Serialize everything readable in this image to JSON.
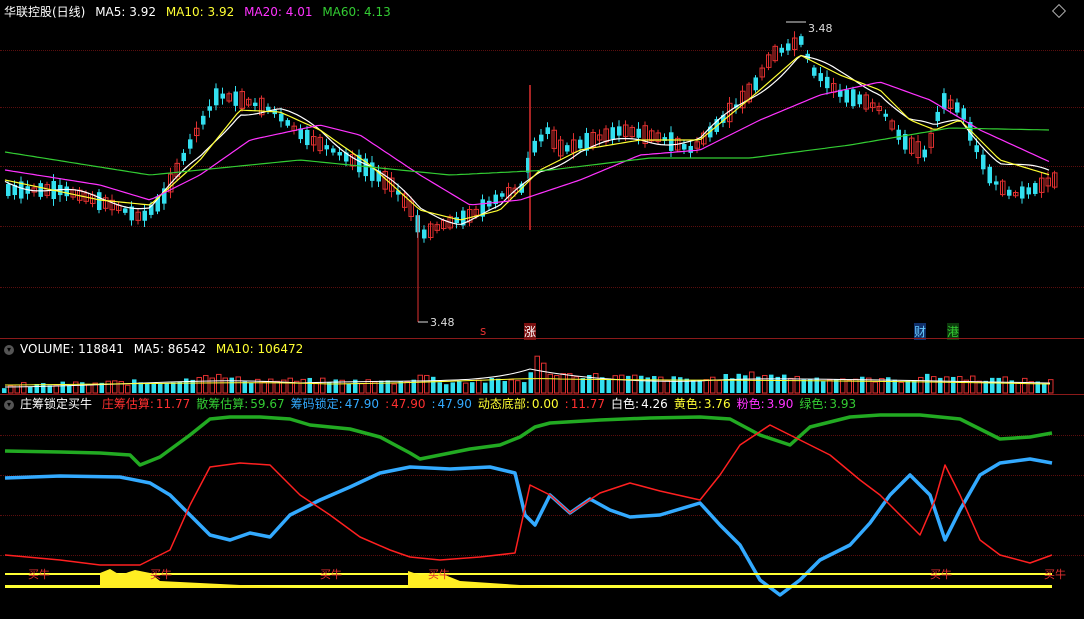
{
  "main": {
    "title": "华联控股(日线)",
    "ma5": "MA5: 3.92",
    "ma10": "MA10: 3.92",
    "ma20": "MA20: 4.01",
    "ma60": "MA60: 4.13",
    "high_label": "3.48",
    "low_label": "3.48",
    "markers": [
      {
        "text": "s",
        "color": "#e03030"
      },
      {
        "text": "涨",
        "color": "#ffffff"
      },
      {
        "text": "财",
        "color": "#66ccff"
      },
      {
        "text": "港",
        "color": "#33cc33"
      }
    ]
  },
  "volume": {
    "label": "VOLUME: 118841",
    "ma5": "MA5: 86542",
    "ma10": "MA10: 106472"
  },
  "indicator": {
    "name": "庄筹锁定买牛",
    "items": [
      {
        "label": "庄筹估算:",
        "value": "11.77",
        "color": "#ff3030"
      },
      {
        "label": "散筹估算:",
        "value": "59.67",
        "color": "#33cc33"
      },
      {
        "label": "筹码锁定:",
        "value": "47.90",
        "color": "#33aaff"
      },
      {
        "label": ":",
        "value": "47.90",
        "color": "#ff3030"
      },
      {
        "label": ":",
        "value": "47.90",
        "color": "#33aaff"
      },
      {
        "label": "动态底部:",
        "value": "0.00",
        "color": "#ffff33"
      },
      {
        "label": ":",
        "value": "11.77",
        "color": "#ff3030"
      },
      {
        "label": "白色:",
        "value": "4.26",
        "color": "#ffffff"
      },
      {
        "label": "黄色:",
        "value": "3.76",
        "color": "#ffff33"
      },
      {
        "label": "粉色:",
        "value": "3.90",
        "color": "#ff33ff"
      },
      {
        "label": "绿色:",
        "value": "3.93",
        "color": "#33cc33"
      }
    ],
    "buy_label": "买牛"
  },
  "colors": {
    "up": "#e03030",
    "down": "#33e0f0",
    "ma5": "#ffffff",
    "ma10": "#ffff33",
    "ma20": "#ff33ff",
    "ma60": "#33cc33",
    "chips_main": "#ff2020",
    "chips_retail": "#22aa22",
    "lock": "#33aaff"
  },
  "icons": [
    "collapse-icon",
    "diamond-icon"
  ]
}
